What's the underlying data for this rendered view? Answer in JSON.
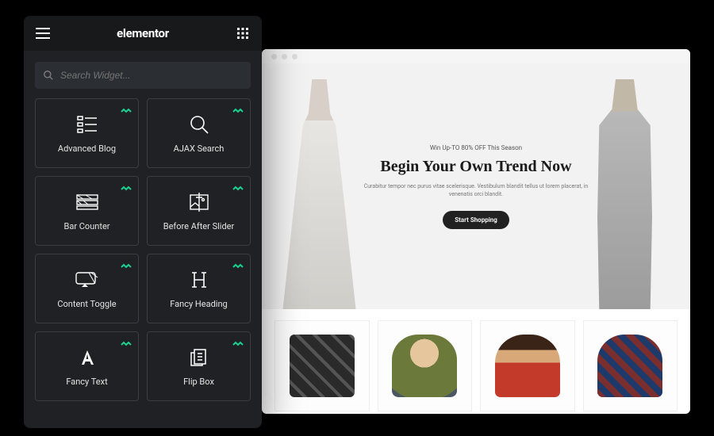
{
  "elementor": {
    "logo": "elementor",
    "search_placeholder": "Search Widget...",
    "widgets": [
      {
        "label": "Advanced Blog"
      },
      {
        "label": "AJAX Search"
      },
      {
        "label": "Bar Counter"
      },
      {
        "label": "Before After Slider"
      },
      {
        "label": "Content Toggle"
      },
      {
        "label": "Fancy Heading"
      },
      {
        "label": "Fancy Text"
      },
      {
        "label": "Flip Box"
      }
    ]
  },
  "site": {
    "hero": {
      "eyebrow": "Win Up-TO 80% OFF This Season",
      "title": "Begin Your Own Trend Now",
      "subtitle": "Curabitur tempor nec purus vitae scelerisque. Vestibulum blandit tellus ut lorem placerat, in venenatis orci blandit.",
      "cta": "Start Shopping"
    }
  }
}
